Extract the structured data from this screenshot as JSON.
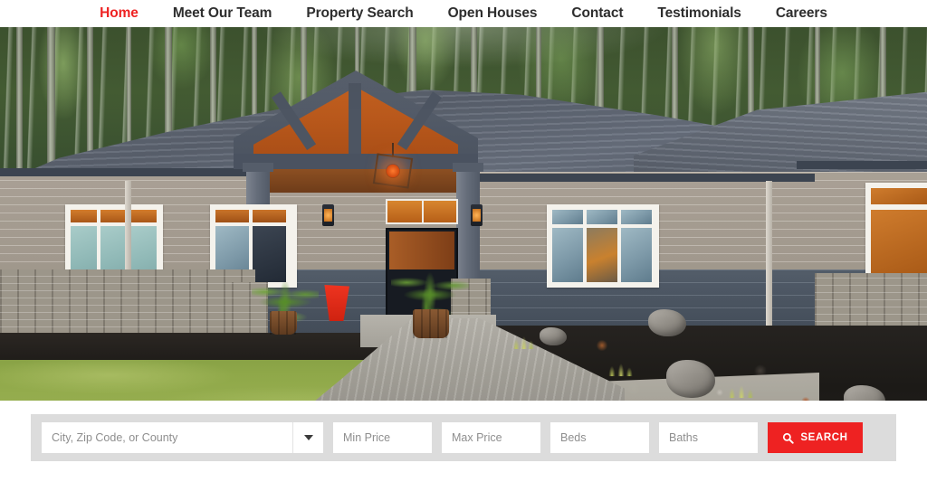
{
  "nav": {
    "items": [
      {
        "label": "Home",
        "active": true
      },
      {
        "label": "Meet Our Team",
        "active": false
      },
      {
        "label": "Property Search",
        "active": false
      },
      {
        "label": "Open Houses",
        "active": false
      },
      {
        "label": "Contact",
        "active": false
      },
      {
        "label": "Testimonials",
        "active": false
      },
      {
        "label": "Careers",
        "active": false
      }
    ],
    "active_color": "#ee2222",
    "text_color": "#2e2e2e"
  },
  "hero": {
    "alt": "Craftsman style gray house with gabled entry, stone veneer, forest backdrop and curved concrete walkway",
    "description": "Single story craftsman home at dusk with warm interior lighting"
  },
  "search": {
    "location": {
      "placeholder": "City, Zip Code, or County",
      "value": ""
    },
    "min_price": {
      "placeholder": "Min Price",
      "value": ""
    },
    "max_price": {
      "placeholder": "Max Price",
      "value": ""
    },
    "beds": {
      "placeholder": "Beds",
      "value": ""
    },
    "baths": {
      "placeholder": "Baths",
      "value": ""
    },
    "submit_label": "SEARCH",
    "submit_color": "#ee2222",
    "bar_background": "#dcdcdc"
  }
}
